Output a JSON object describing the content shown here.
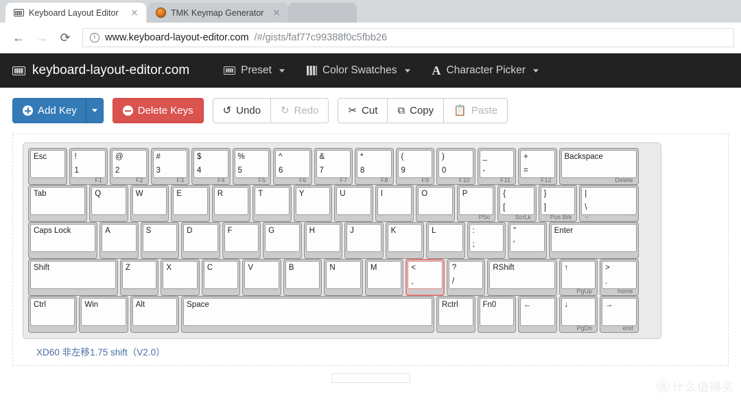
{
  "browser": {
    "tabs": [
      {
        "title": "Keyboard Layout Editor",
        "favicon": "keyboard-icon",
        "active": true
      },
      {
        "title": "TMK Keymap Generator",
        "favicon": "coffee-icon",
        "active": false
      }
    ],
    "nav": {
      "back_icon": "←",
      "forward_icon": "→",
      "reload_icon": "⟳"
    },
    "url": {
      "security_icon": "info-icon",
      "host": "www.keyboard-layout-editor.com",
      "path": "/#/gists/faf77c99388f0c5fbb26"
    }
  },
  "appbar": {
    "brand": "keyboard-layout-editor.com",
    "menus": [
      {
        "label": "Preset",
        "icon": "keyboard-icon"
      },
      {
        "label": "Color Swatches",
        "icon": "swatches-icon"
      },
      {
        "label": "Character Picker",
        "icon": "font-a-icon"
      }
    ]
  },
  "toolbar": {
    "add_key": "Add Key",
    "delete_keys": "Delete Keys",
    "undo": "Undo",
    "redo": "Redo",
    "cut": "Cut",
    "copy": "Copy",
    "paste": "Paste",
    "undo_icon": "↺",
    "redo_icon": "↻",
    "cut_icon": "✂",
    "copy_icon": "⧉",
    "paste_icon": "Ὄb",
    "disabled": [
      "Redo",
      "Paste"
    ]
  },
  "editor": {
    "caption": "XD60 非左移1.75 shift（V2.0）",
    "selected_key": "< ,",
    "rows": [
      [
        {
          "w": 1,
          "tl": "Esc"
        },
        {
          "w": 1,
          "tl": "!",
          "bl": "1",
          "fl": "",
          "fr": "F1"
        },
        {
          "w": 1,
          "tl": "@",
          "bl": "2",
          "fr": "F2"
        },
        {
          "w": 1,
          "tl": "#",
          "bl": "3",
          "fr": "F3"
        },
        {
          "w": 1,
          "tl": "$",
          "bl": "4",
          "fr": "F4"
        },
        {
          "w": 1,
          "tl": "%",
          "bl": "5",
          "fr": "F5"
        },
        {
          "w": 1,
          "tl": "^",
          "bl": "6",
          "fr": "F6"
        },
        {
          "w": 1,
          "tl": "&",
          "bl": "7",
          "fr": "F7"
        },
        {
          "w": 1,
          "tl": "*",
          "bl": "8",
          "fr": "F8"
        },
        {
          "w": 1,
          "tl": "(",
          "bl": "9",
          "fr": "F9"
        },
        {
          "w": 1,
          "tl": ")",
          "bl": "0",
          "fr": "F10"
        },
        {
          "w": 1,
          "tl": "_",
          "bl": "-",
          "fr": "F11"
        },
        {
          "w": 1,
          "tl": "+",
          "bl": "=",
          "fr": "F12"
        },
        {
          "w": 2,
          "tl": "Backspace",
          "fr": "Delete"
        }
      ],
      [
        {
          "w": 1.5,
          "tl": "Tab"
        },
        {
          "w": 1,
          "tl": "Q"
        },
        {
          "w": 1,
          "tl": "W"
        },
        {
          "w": 1,
          "tl": "E"
        },
        {
          "w": 1,
          "tl": "R"
        },
        {
          "w": 1,
          "tl": "T"
        },
        {
          "w": 1,
          "tl": "Y"
        },
        {
          "w": 1,
          "tl": "U"
        },
        {
          "w": 1,
          "tl": "I"
        },
        {
          "w": 1,
          "tl": "O"
        },
        {
          "w": 1,
          "tl": "P",
          "fr": "PSc"
        },
        {
          "w": 1,
          "tl": "{",
          "bl": "[",
          "fr": "ScrLk"
        },
        {
          "w": 1,
          "tl": "}",
          "bl": "]",
          "fr": "Pus Brk"
        },
        {
          "w": 1.5,
          "tl": "|",
          "bl": "\\",
          "fl": "~",
          "fr": "`"
        }
      ],
      [
        {
          "w": 1.75,
          "tl": "Caps Lock"
        },
        {
          "w": 1,
          "tl": "A"
        },
        {
          "w": 1,
          "tl": "S"
        },
        {
          "w": 1,
          "tl": "D"
        },
        {
          "w": 1,
          "tl": "F"
        },
        {
          "w": 1,
          "tl": "G"
        },
        {
          "w": 1,
          "tl": "H"
        },
        {
          "w": 1,
          "tl": "J"
        },
        {
          "w": 1,
          "tl": "K"
        },
        {
          "w": 1,
          "tl": "L"
        },
        {
          "w": 1,
          "tl": ":",
          "bl": ";"
        },
        {
          "w": 1,
          "tl": "\"",
          "bl": "'"
        },
        {
          "w": 2.25,
          "tl": "Enter"
        }
      ],
      [
        {
          "w": 2.25,
          "tl": "Shift"
        },
        {
          "w": 1,
          "tl": "Z"
        },
        {
          "w": 1,
          "tl": "X"
        },
        {
          "w": 1,
          "tl": "C"
        },
        {
          "w": 1,
          "tl": "V"
        },
        {
          "w": 1,
          "tl": "B"
        },
        {
          "w": 1,
          "tl": "N"
        },
        {
          "w": 1,
          "tl": "M"
        },
        {
          "w": 1,
          "tl": "<",
          "bl": ",",
          "selected": true
        },
        {
          "w": 1,
          "tl": "?",
          "bl": "/"
        },
        {
          "w": 1.75,
          "tl": "RShift"
        },
        {
          "w": 1,
          "tl": "↑",
          "fr": "PgUp"
        },
        {
          "w": 1,
          "tl": ">",
          "bl": ".",
          "fr": "home"
        }
      ],
      [
        {
          "w": 1.25,
          "tl": "Ctrl"
        },
        {
          "w": 1.25,
          "tl": "Win"
        },
        {
          "w": 1.25,
          "tl": "Alt"
        },
        {
          "w": 6.25,
          "tl": "Space"
        },
        {
          "w": 1,
          "tl": "Rctrl"
        },
        {
          "w": 1,
          "tl": "Fn0"
        },
        {
          "w": 1,
          "tl": "←"
        },
        {
          "w": 1,
          "tl": "↓",
          "fr": "PgDn"
        },
        {
          "w": 1,
          "tl": "→",
          "fr": "end"
        }
      ]
    ]
  },
  "watermark": {
    "mark": "值",
    "text": "什么值得买"
  }
}
